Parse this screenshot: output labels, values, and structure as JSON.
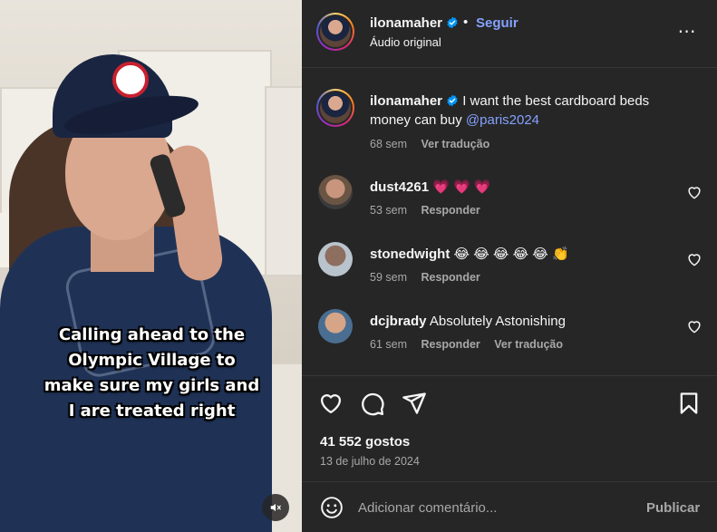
{
  "post": {
    "username": "ilonamaher",
    "separator": "•",
    "follow_label": "Seguir",
    "audio_label": "Áudio original",
    "more_label": "⋯"
  },
  "video": {
    "caption": "Calling ahead to the\nOlympic Village to\nmake sure my girls and\nI are treated right",
    "muted": true
  },
  "caption_comment": {
    "username": "ilonamaher",
    "text": "I want the best cardboard beds money can buy",
    "mention": "@paris2024",
    "time": "68 sem",
    "translate_label": "Ver tradução"
  },
  "comments": [
    {
      "username": "dust4261",
      "text": "💗 💗 💗",
      "time": "53 sem",
      "reply_label": "Responder"
    },
    {
      "username": "stonedwight",
      "text": "😂 😂 😂 😂 😂 👏",
      "time": "59 sem",
      "reply_label": "Responder"
    },
    {
      "username": "dcjbrady",
      "text": "Absolutely Astonishing",
      "time": "61 sem",
      "reply_label": "Responder",
      "translate_label": "Ver tradução"
    }
  ],
  "stats": {
    "likes": "41 552 gostos",
    "date": "13 de julho de 2024"
  },
  "composer": {
    "placeholder": "Adicionar comentário...",
    "publish_label": "Publicar"
  },
  "colors": {
    "panel_bg": "#262626",
    "link_blue": "#85a1ff",
    "verified_blue": "#0095f6",
    "muted_text": "#a8a8a8"
  }
}
